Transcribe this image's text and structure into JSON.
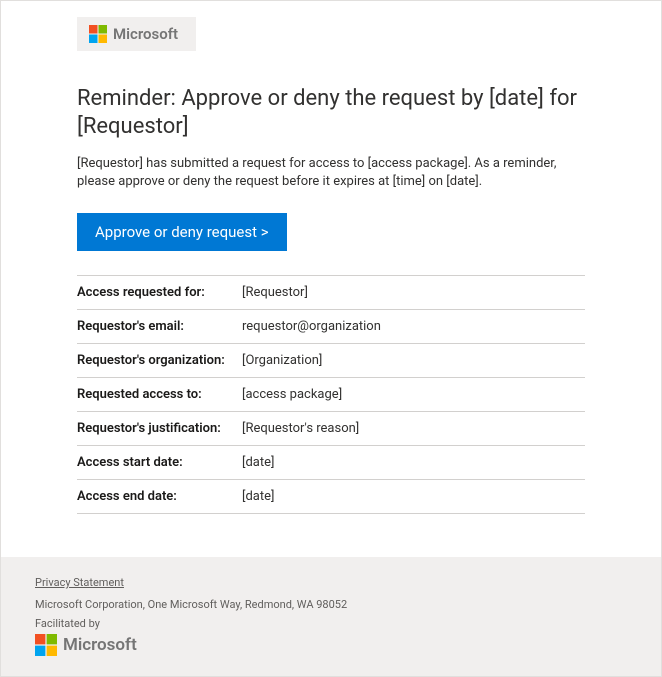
{
  "brand": "Microsoft",
  "title": "Reminder: Approve or deny the request by [date] for [Requestor]",
  "description": "[Requestor] has submitted a request for access to [access package]. As a reminder, please approve or deny the request before it expires at [time] on [date].",
  "button_label": "Approve or deny request >",
  "details": {
    "rows": [
      {
        "label": "Access requested for:",
        "value": "[Requestor]"
      },
      {
        "label": "Requestor's email:",
        "value": "requestor@organization"
      },
      {
        "label": "Requestor's organization:",
        "value": "[Organization]"
      },
      {
        "label": "Requested access to:",
        "value": "[access package]"
      },
      {
        "label": "Requestor's justification:",
        "value": "[Requestor's reason]"
      },
      {
        "label": "Access start date:",
        "value": "[date]"
      },
      {
        "label": "Access end date:",
        "value": "[date]"
      }
    ]
  },
  "footer": {
    "privacy_label": "Privacy Statement",
    "address": "Microsoft Corporation, One Microsoft Way, Redmond, WA 98052",
    "facilitated_by": "Facilitated by",
    "facilitator_brand": "Microsoft"
  },
  "colors": {
    "brand_accent": "#0078d4",
    "ms_red": "#f25022",
    "ms_green": "#7fba00",
    "ms_blue": "#00a4ef",
    "ms_yellow": "#ffb900"
  }
}
